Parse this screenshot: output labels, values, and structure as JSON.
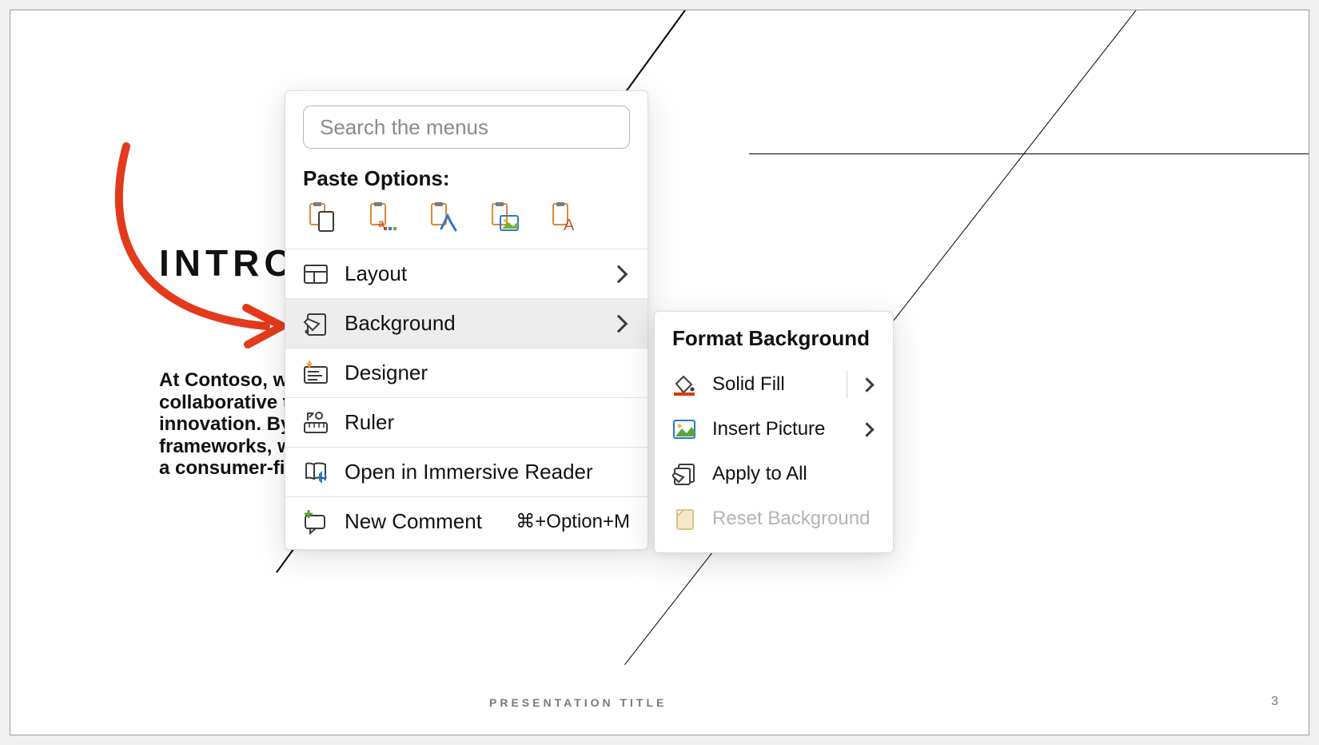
{
  "slide": {
    "title": "INTRODU",
    "body": "At Contoso, we e\ncollaborative thi\ninnovation. By cl\nframeworks, we l\na consumer-first",
    "footer_title": "PRESENTATION TITLE",
    "page_number": "3"
  },
  "context_menu": {
    "search_placeholder": "Search the menus",
    "paste_options_label": "Paste Options:",
    "items": [
      {
        "label": "Layout",
        "has_submenu": true
      },
      {
        "label": "Background",
        "has_submenu": true,
        "highlighted": true
      },
      {
        "label": "Designer",
        "has_submenu": false
      },
      {
        "label": "Ruler",
        "has_submenu": false
      },
      {
        "label": "Open in Immersive Reader",
        "has_submenu": false
      },
      {
        "label": "New Comment",
        "has_submenu": false,
        "shortcut": "⌘+Option+M"
      }
    ]
  },
  "submenu": {
    "title": "Format Background",
    "items": [
      {
        "label": "Solid Fill",
        "has_submenu": true,
        "has_divider": true
      },
      {
        "label": "Insert Picture",
        "has_submenu": true
      },
      {
        "label": "Apply to All",
        "has_submenu": false
      },
      {
        "label": "Reset Background",
        "has_submenu": false,
        "disabled": true
      }
    ]
  }
}
